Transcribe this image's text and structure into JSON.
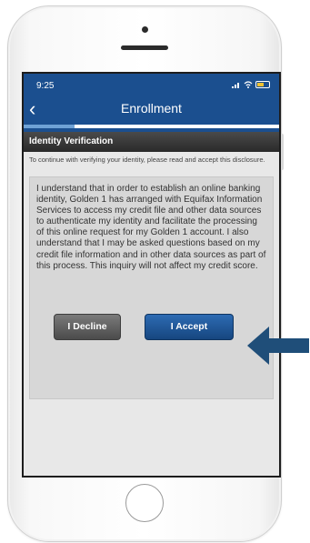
{
  "status_bar": {
    "time": "9:25",
    "signal_icon": "signal-bars-icon",
    "wifi_icon": "wifi-icon",
    "battery_icon": "battery-icon"
  },
  "nav": {
    "back_glyph": "‹",
    "title": "Enrollment",
    "bar_color": "#1b4f8f"
  },
  "progress": {
    "fraction": 0.2
  },
  "section": {
    "title": "Identity Verification"
  },
  "intro_text": "To continue with verifying your identity, please read and accept this disclosure.",
  "disclosure_text": "I understand that in order to establish an online banking identity, Golden 1 has arranged with Equifax Information Services to access my credit file and other data sources to authenticate my identity and facilitate the processing of this online request for my Golden 1 account. I also understand that I may be asked questions based on my credit file information and in other data sources as part of this process. This inquiry will not affect my credit score.",
  "buttons": {
    "decline_label": "I Decline",
    "accept_label": "I Accept"
  },
  "annotation": {
    "arrow_color": "#1f4e79"
  }
}
